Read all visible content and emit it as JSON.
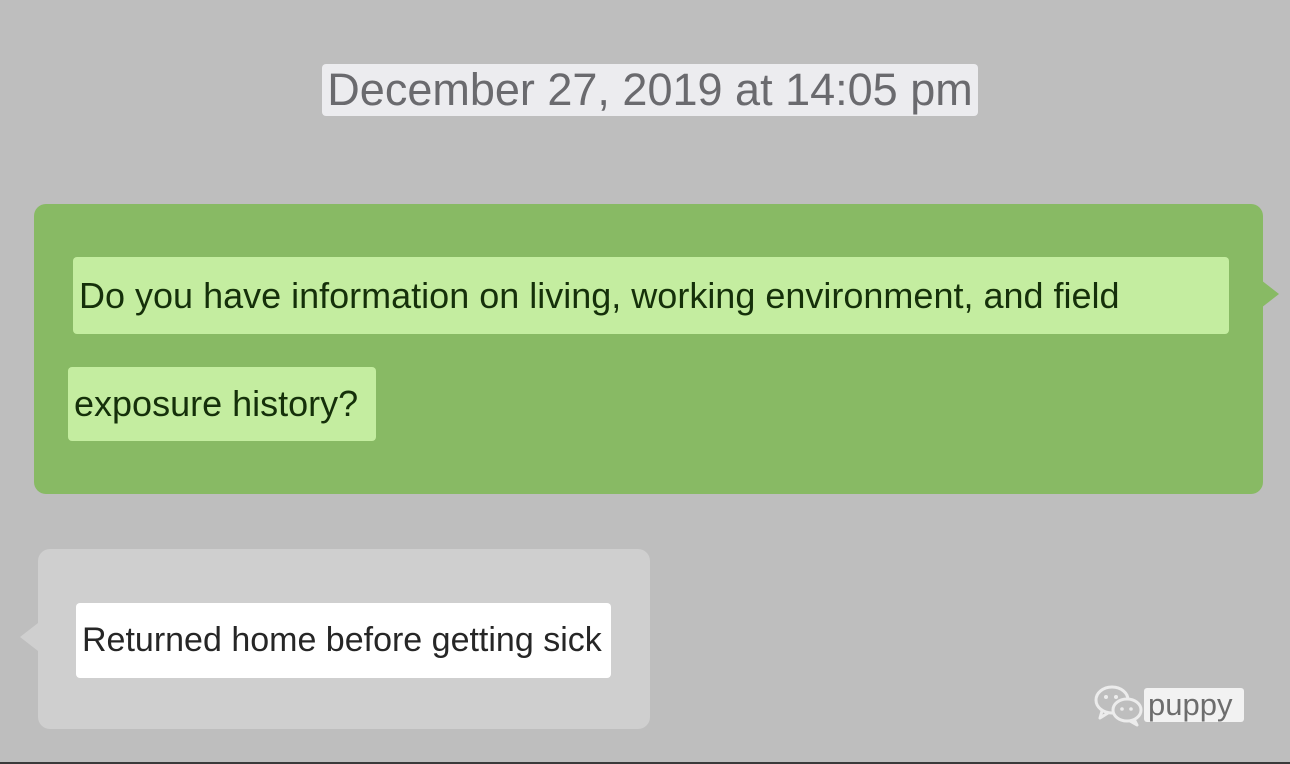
{
  "timestamp": "December 27, 2019 at 14:05 pm",
  "messages": [
    {
      "direction": "outgoing",
      "lines": [
        "Do you have information on living, working environment, and field",
        "exposure history?"
      ]
    },
    {
      "direction": "incoming",
      "lines": [
        "Returned home before getting sick"
      ]
    }
  ],
  "watermark": {
    "icon": "chat-bubbles-icon",
    "text": "puppy"
  },
  "colors": {
    "background": "#bebebe",
    "outgoing_bubble": "#88ba64",
    "outgoing_highlight": "#c4eda0",
    "incoming_bubble": "#cfcfcf",
    "incoming_highlight": "#ffffff"
  }
}
